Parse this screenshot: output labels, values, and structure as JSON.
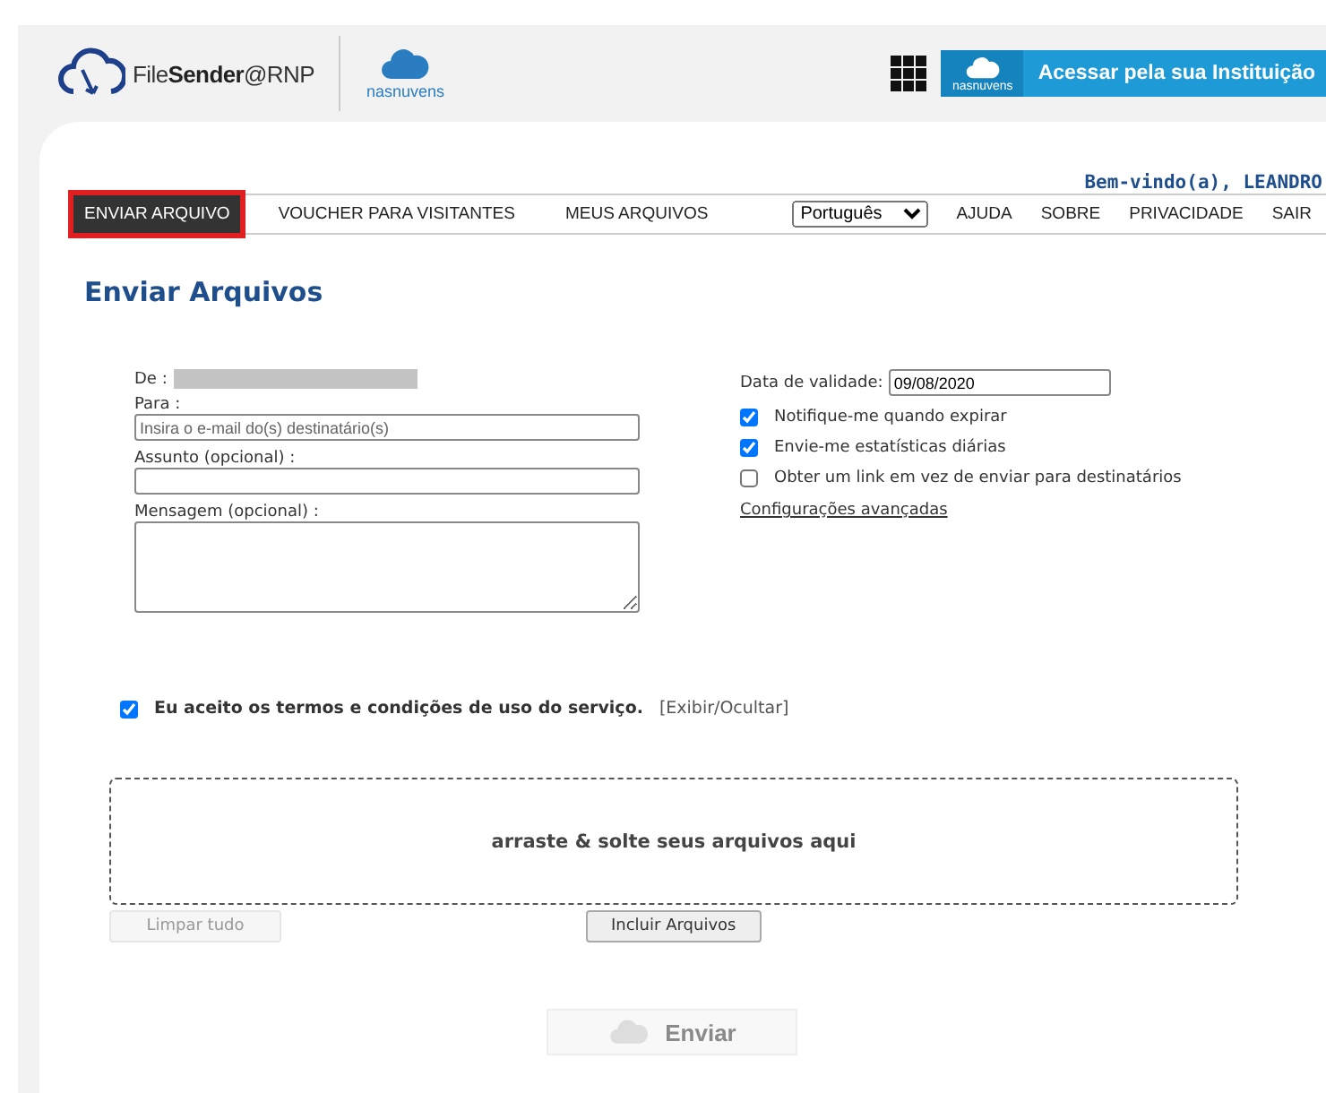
{
  "header": {
    "logo_text_regular": "File",
    "logo_text_bold": "Sender",
    "logo_text_suffix": "@RNP",
    "partner_logo": "nasnuvens",
    "login_button": {
      "badge": "nasnuvens",
      "label": "Acessar pela sua Instituição"
    }
  },
  "welcome": "Bem-vindo(a), LEANDRO",
  "nav": {
    "left": [
      {
        "label": "ENVIAR ARQUIVO",
        "selected": true
      },
      {
        "label": "VOUCHER PARA VISITANTES",
        "selected": false
      },
      {
        "label": "MEUS ARQUIVOS",
        "selected": false
      }
    ],
    "language": "Português",
    "right": [
      "AJUDA",
      "SOBRE",
      "PRIVACIDADE",
      "SAIR"
    ]
  },
  "page_title": "Enviar Arquivos",
  "form": {
    "from_label": "De :",
    "to_label": "Para :",
    "to_placeholder": "Insira o e-mail do(s) destinatário(s)",
    "subject_label": "Assunto (opcional) :",
    "message_label": "Mensagem (opcional) :"
  },
  "options": {
    "expiry_label": "Data de validade:",
    "expiry_value": "09/08/2020",
    "checkboxes": [
      {
        "label": "Notifique-me quando expirar",
        "checked": true
      },
      {
        "label": "Envie-me estatísticas diárias",
        "checked": true
      },
      {
        "label": "Obter um link em vez de enviar para destinatários",
        "checked": false
      }
    ],
    "advanced_link": "Configurações avançadas"
  },
  "terms": {
    "checked": true,
    "text": "Eu aceito os termos e condições de uso do serviço.",
    "toggle": "[Exibir/Ocultar]"
  },
  "dropzone": "arraste & solte seus arquivos aqui",
  "buttons": [
    {
      "label": "Limpar tudo",
      "disabled": true
    },
    {
      "label": "Incluir Arquivos",
      "disabled": false
    }
  ],
  "send_button": {
    "label": "Enviar",
    "disabled": true
  }
}
